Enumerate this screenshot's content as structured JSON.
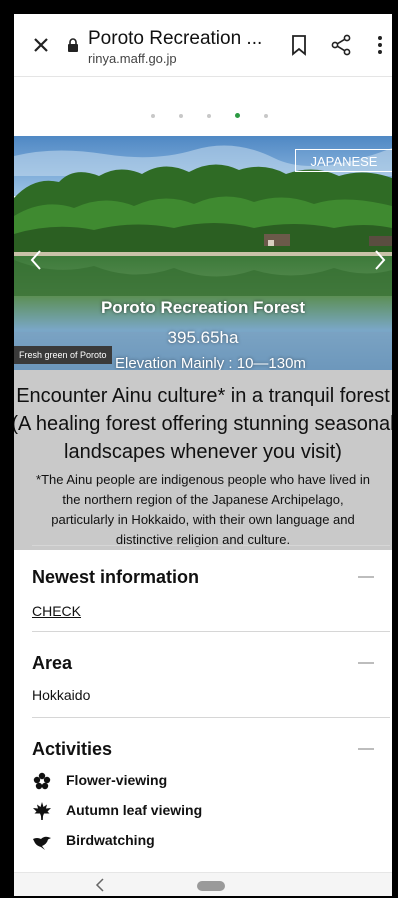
{
  "browser": {
    "title": "Poroto Recreation ...",
    "url": "rinya.maff.go.jp"
  },
  "carousel": {
    "dot_count": 5,
    "active_index": 3
  },
  "hero": {
    "lang_button": "JAPANESE",
    "title": "Poroto Recreation Forest",
    "area": "395.65ha",
    "elevation": "Elevation Mainly : 10—130m",
    "caption": "Fresh green of Poroto"
  },
  "intro": {
    "lead_line1": "Encounter Ainu culture* in a tranquil forest",
    "lead_line2": "(A healing forest offering stunning seasonal",
    "lead_line3": "landscapes whenever you visit)",
    "note_line1": "*The Ainu people are indigenous people who have lived in",
    "note_line2": "the northern region of the Japanese Archipelago,",
    "note_line3": "particularly in Hokkaido, with their own language and",
    "note_line4": "distinctive religion and culture."
  },
  "sections": {
    "newest": {
      "heading": "Newest information",
      "link": "CHECK"
    },
    "area": {
      "heading": "Area",
      "value": "Hokkaido"
    },
    "activities": {
      "heading": "Activities",
      "items": [
        {
          "icon": "flower-icon",
          "label": "Flower-viewing"
        },
        {
          "icon": "maple-leaf-icon",
          "label": "Autumn leaf viewing"
        },
        {
          "icon": "bird-icon",
          "label": "Birdwatching"
        }
      ]
    }
  },
  "colors": {
    "accent_dot": "#2c9a43",
    "desc_background": "#c9c9c9"
  }
}
